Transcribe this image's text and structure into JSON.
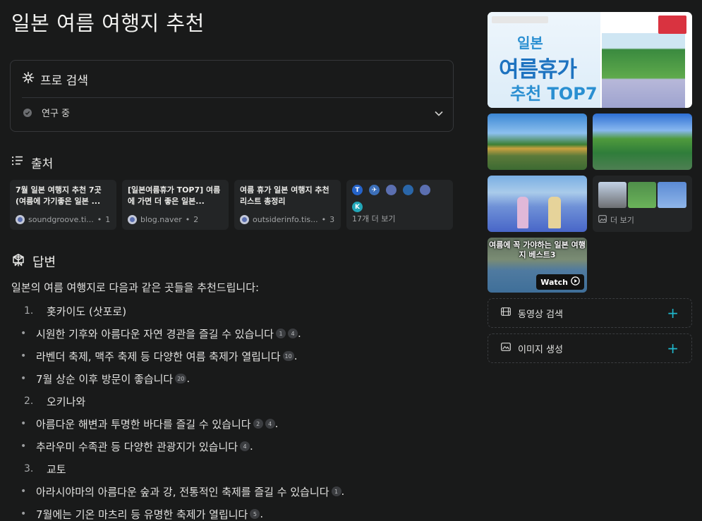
{
  "title": "일본 여름 여행지 추천",
  "pro_search": {
    "label": "프로 검색",
    "status": "연구 중"
  },
  "sources": {
    "heading": "출처",
    "cards": [
      {
        "title": "7월 일본 여행지 추천 7곳 (여름에 가기좋은 일본 ...",
        "domain": "soundgroove.ti...",
        "index": "1"
      },
      {
        "title": "[일본여름휴가 TOP7] 여름에 가면 더 좋은 일본...",
        "domain": "blog.naver",
        "index": "2"
      },
      {
        "title": "여름 휴가 일본 여행지 추천 리스트 총정리",
        "domain": "outsiderinfo.tis...",
        "index": "3"
      }
    ],
    "more_label": "17개 더 보기",
    "more_icons": [
      {
        "text": "T",
        "color": "#2563c9"
      },
      {
        "text": "✈",
        "color": "#3c6fb8"
      },
      {
        "text": "",
        "color": "#5b6fb0"
      },
      {
        "text": "",
        "color": "#2a66a8"
      },
      {
        "text": "",
        "color": "#5b6fb0"
      },
      {
        "text": "K",
        "color": "#22a7b8"
      }
    ]
  },
  "answer": {
    "heading": "답변",
    "intro": "일본의 여름 여행지로 다음과 같은 곳들을 추천드립니다:",
    "items": [
      {
        "type": "num",
        "marker": "1.",
        "text": "홋카이도 (삿포로)",
        "cites": []
      },
      {
        "type": "bullet",
        "marker": "•",
        "text": "시원한 기후와 아름다운 자연 경관을 즐길 수 있습니다",
        "cites": [
          "1",
          "4"
        ]
      },
      {
        "type": "bullet",
        "marker": "•",
        "text": "라벤더 축제, 맥주 축제 등 다양한 여름 축제가 열립니다",
        "cites": [
          "10"
        ]
      },
      {
        "type": "bullet",
        "marker": "•",
        "text": "7월 상순 이후 방문이 좋습니다",
        "cites": [
          "20"
        ]
      },
      {
        "type": "num",
        "marker": "2.",
        "text": "오키나와",
        "cites": []
      },
      {
        "type": "bullet",
        "marker": "•",
        "text": "아름다운 해변과 투명한 바다를 즐길 수 있습니다",
        "cites": [
          "2",
          "4"
        ]
      },
      {
        "type": "bullet",
        "marker": "•",
        "text": "추라우미 수족관 등 다양한 관광지가 있습니다",
        "cites": [
          "4"
        ]
      },
      {
        "type": "num",
        "marker": "3.",
        "text": "교토",
        "cites": []
      },
      {
        "type": "bullet",
        "marker": "•",
        "text": "아라시야마의 아름다운 숲과 강, 전통적인 축제를 즐길 수 있습니다",
        "cites": [
          "1"
        ]
      },
      {
        "type": "bullet",
        "marker": "•",
        "text": "7월에는 기온 마츠리 등 유명한 축제가 열립니다",
        "cites": [
          "5"
        ]
      }
    ]
  },
  "media": {
    "hero": {
      "line1": "일본",
      "line2": "여름휴가",
      "line3": "추천 TOP7"
    },
    "more_images_label": "더 보기",
    "video": {
      "text": "여름에 꼭 가야하는 일본 여행지 베스트3",
      "watch_label": "Watch"
    },
    "actions": [
      {
        "label": "동영상 검색",
        "icon": "film-icon"
      },
      {
        "label": "이미지 생성",
        "icon": "image-generate-icon"
      }
    ]
  },
  "colors": {
    "background": "#191a1a",
    "accent": "#1fb8cd",
    "card": "#232526"
  }
}
